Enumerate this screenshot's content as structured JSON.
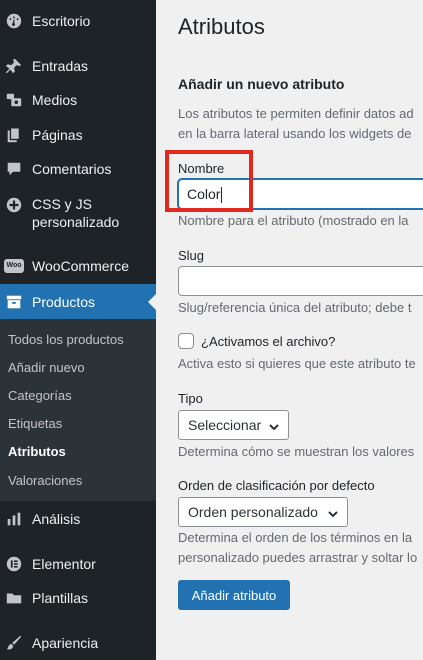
{
  "sidebar": {
    "items": [
      {
        "label": "Escritorio",
        "icon": "dashboard-icon"
      },
      {
        "label": "Entradas",
        "icon": "pin-icon"
      },
      {
        "label": "Medios",
        "icon": "media-icon"
      },
      {
        "label": "Páginas",
        "icon": "pages-icon"
      },
      {
        "label": "Comentarios",
        "icon": "comment-icon"
      },
      {
        "label_line1": "CSS y JS",
        "label_line2": "personalizado",
        "icon": "plus-circle-icon"
      },
      {
        "label": "WooCommerce",
        "icon": "woo-icon",
        "icon_text": "Woo"
      },
      {
        "label": "Productos",
        "icon": "products-icon"
      },
      {
        "label": "Análisis",
        "icon": "chart-bar-icon"
      },
      {
        "label": "Elementor",
        "icon": "elementor-icon"
      },
      {
        "label": "Plantillas",
        "icon": "folder-icon"
      },
      {
        "label": "Apariencia",
        "icon": "brush-icon"
      }
    ],
    "submenu": [
      "Todos los productos",
      "Añadir nuevo",
      "Categorías",
      "Etiquetas",
      "Atributos",
      "Valoraciones"
    ],
    "active_item": "Productos",
    "current_sub": "Atributos"
  },
  "main": {
    "title": "Atributos",
    "section_title": "Añadir un nuevo atributo",
    "intro_line1": "Los atributos te permiten definir datos ad",
    "intro_line2": "en la barra lateral usando los widgets de",
    "name": {
      "label": "Nombre",
      "value": "Color",
      "help": "Nombre para el atributo (mostrado en la"
    },
    "slug": {
      "label": "Slug",
      "value": "",
      "help": "Slug/referencia única del atributo; debe t"
    },
    "archive": {
      "label": "¿Activamos el archivo?",
      "checked": false,
      "help": "Activa esto si quieres que este atributo te"
    },
    "type": {
      "label": "Tipo",
      "value": "Seleccionar",
      "help": "Determina cómo se muestran los valores"
    },
    "order": {
      "label": "Orden de clasificación por defecto",
      "value": "Orden personalizado",
      "help_line1": "Determina el orden de los términos en la",
      "help_line2": "personalizado puedes arrastrar y soltar lo"
    },
    "submit_label": "Añadir atributo"
  },
  "colors": {
    "accent": "#2271b1",
    "sidebar_bg": "#1d2327",
    "submenu_bg": "#2c3338",
    "highlight": "#e12a1f"
  }
}
